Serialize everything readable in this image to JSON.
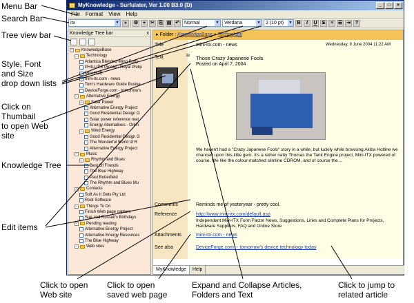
{
  "annotations": {
    "menu_bar": "Menu Bar",
    "search_bar": "Search Bar",
    "tree_view_bar": "Tree view bar",
    "style_font": [
      "Style, Font",
      "and Size",
      "drop down lists"
    ],
    "thumbnail": [
      "Click on",
      "Thumbail",
      "to open Web",
      "site"
    ],
    "knowledge_tree": "Knowledge Tree",
    "edit_items": "Edit items",
    "open_web": [
      "Click to open",
      "Web site"
    ],
    "open_saved": [
      "Click to open",
      "saved web page"
    ],
    "expand_collapse": [
      "Expand and Collapse Articles,",
      "Folders and Text"
    ],
    "jump_related": [
      "Click to jump to",
      "related article"
    ]
  },
  "window": {
    "title": "MyKnowledge - Surfulater, Ver 1.00 B3.0 (D)",
    "menu": [
      "File",
      "Format",
      "View",
      "Help"
    ],
    "toolbar": {
      "search_value": "itx",
      "style_value": "Normal",
      "font_value": "Verdana",
      "size_value": "2 (10 pt)",
      "format_buttons": [
        "B",
        "I",
        "U",
        "S"
      ]
    }
  },
  "tree_pane": {
    "header": "Knowledge Tree bar",
    "close": "x",
    "items": [
      {
        "level": 0,
        "type": "folder",
        "label": "KnowledgeBase"
      },
      {
        "level": 1,
        "type": "folder",
        "label": "Technology"
      },
      {
        "level": 2,
        "type": "page",
        "label": "Atlantica Blended Wing Body"
      },
      {
        "level": 2,
        "type": "page",
        "label": "PHILLIPS Pronto - Royal Philip"
      },
      {
        "level": 2,
        "type": "page",
        "label": "Mini HDD"
      },
      {
        "level": 2,
        "type": "page",
        "label": "mini-itx.com - news"
      },
      {
        "level": 2,
        "type": "page",
        "label": "Tom's Hardware Guide Busine"
      },
      {
        "level": 2,
        "type": "page",
        "label": "DeviceForge.com - tomorrow's"
      },
      {
        "level": 1,
        "type": "folder",
        "label": "Alternative Energy"
      },
      {
        "level": 2,
        "type": "folder",
        "label": "Solar Power"
      },
      {
        "level": 3,
        "type": "page",
        "label": "Alternative Energy Project"
      },
      {
        "level": 3,
        "type": "page",
        "label": "Good Residential Design G"
      },
      {
        "level": 3,
        "type": "page",
        "label": "Solar power reference reat"
      },
      {
        "level": 3,
        "type": "page",
        "label": "Energy Alternatives - Onlin"
      },
      {
        "level": 2,
        "type": "folder",
        "label": "Wind Energy"
      },
      {
        "level": 3,
        "type": "page",
        "label": "Good Residential Design G"
      },
      {
        "level": 3,
        "type": "page",
        "label": "The Wonderful World of R"
      },
      {
        "level": 3,
        "type": "page",
        "label": "Alternative Energy Project"
      },
      {
        "level": 1,
        "type": "folder",
        "label": "Music"
      },
      {
        "level": 2,
        "type": "folder",
        "label": "Rhythm and Blues"
      },
      {
        "level": 3,
        "type": "page",
        "label": "Best Of Friends"
      },
      {
        "level": 3,
        "type": "page",
        "label": "The Blue Highway"
      },
      {
        "level": 3,
        "type": "page",
        "label": "Paul Butterfield"
      },
      {
        "level": 3,
        "type": "page",
        "label": "The Rhythm and Blues Mu"
      },
      {
        "level": 1,
        "type": "folder",
        "label": "Contacts"
      },
      {
        "level": 2,
        "type": "page",
        "label": "Soft As It Gets Pty Ltd"
      },
      {
        "level": 2,
        "type": "page",
        "label": "Root Software"
      },
      {
        "level": 1,
        "type": "folder",
        "label": "Things To Do"
      },
      {
        "level": 2,
        "type": "page",
        "label": "Finish Web page capture"
      },
      {
        "level": 2,
        "type": "page",
        "label": "Sue and Russell's Birthdays"
      },
      {
        "level": 1,
        "type": "folder",
        "label": "Pending reading"
      },
      {
        "level": 2,
        "type": "page",
        "label": "Alternative Energy Project"
      },
      {
        "level": 2,
        "type": "page",
        "label": "Alternative Energy Resources"
      },
      {
        "level": 2,
        "type": "page",
        "label": "The Blue Highway"
      },
      {
        "level": 1,
        "type": "folder",
        "label": "Web sites"
      }
    ]
  },
  "article": {
    "breadcrumb_prefix": "Folder",
    "breadcrumb_links": [
      "KnowledgeBase",
      "Technology"
    ],
    "labels": {
      "title": "Title",
      "text": "Text",
      "comments": "Comments",
      "reference": "Reference",
      "attachments": "Attachments",
      "see_also": "See also"
    },
    "title_value": "mini-itx.com - news",
    "date": "Wednesday, 9 June 2004 11:22 AM",
    "headline": "Those Crazy Japanese Fools",
    "posted": "Posted on April 7, 2004",
    "body": "We haven't had a \"Crazy Japanese Fools\" story in a while, but luckily while browsing Akiba Hotline we chanced upon this little gem. It's a rather natty Thomas the Tank Engine project, Mini-ITX powered of course. We like the colour-matched slimline CDROM, and of course the ...",
    "comments_value": "Reminds me of yesteryear - pretty cool.",
    "reference_url": "http://www.mini-itx.com/default.asp",
    "reference_desc": "Independent Mini-ITX Form Factor News, Suggestions, Links and Complete Plans for Projects, Hardware Suppliers, FAQ and Online Store",
    "attachments_value": "mini-itx.com - news",
    "see_also_value": "DeviceForge.com -- tomorrow's device technology today",
    "tabs": [
      "MyKnowledge",
      "Help"
    ]
  }
}
